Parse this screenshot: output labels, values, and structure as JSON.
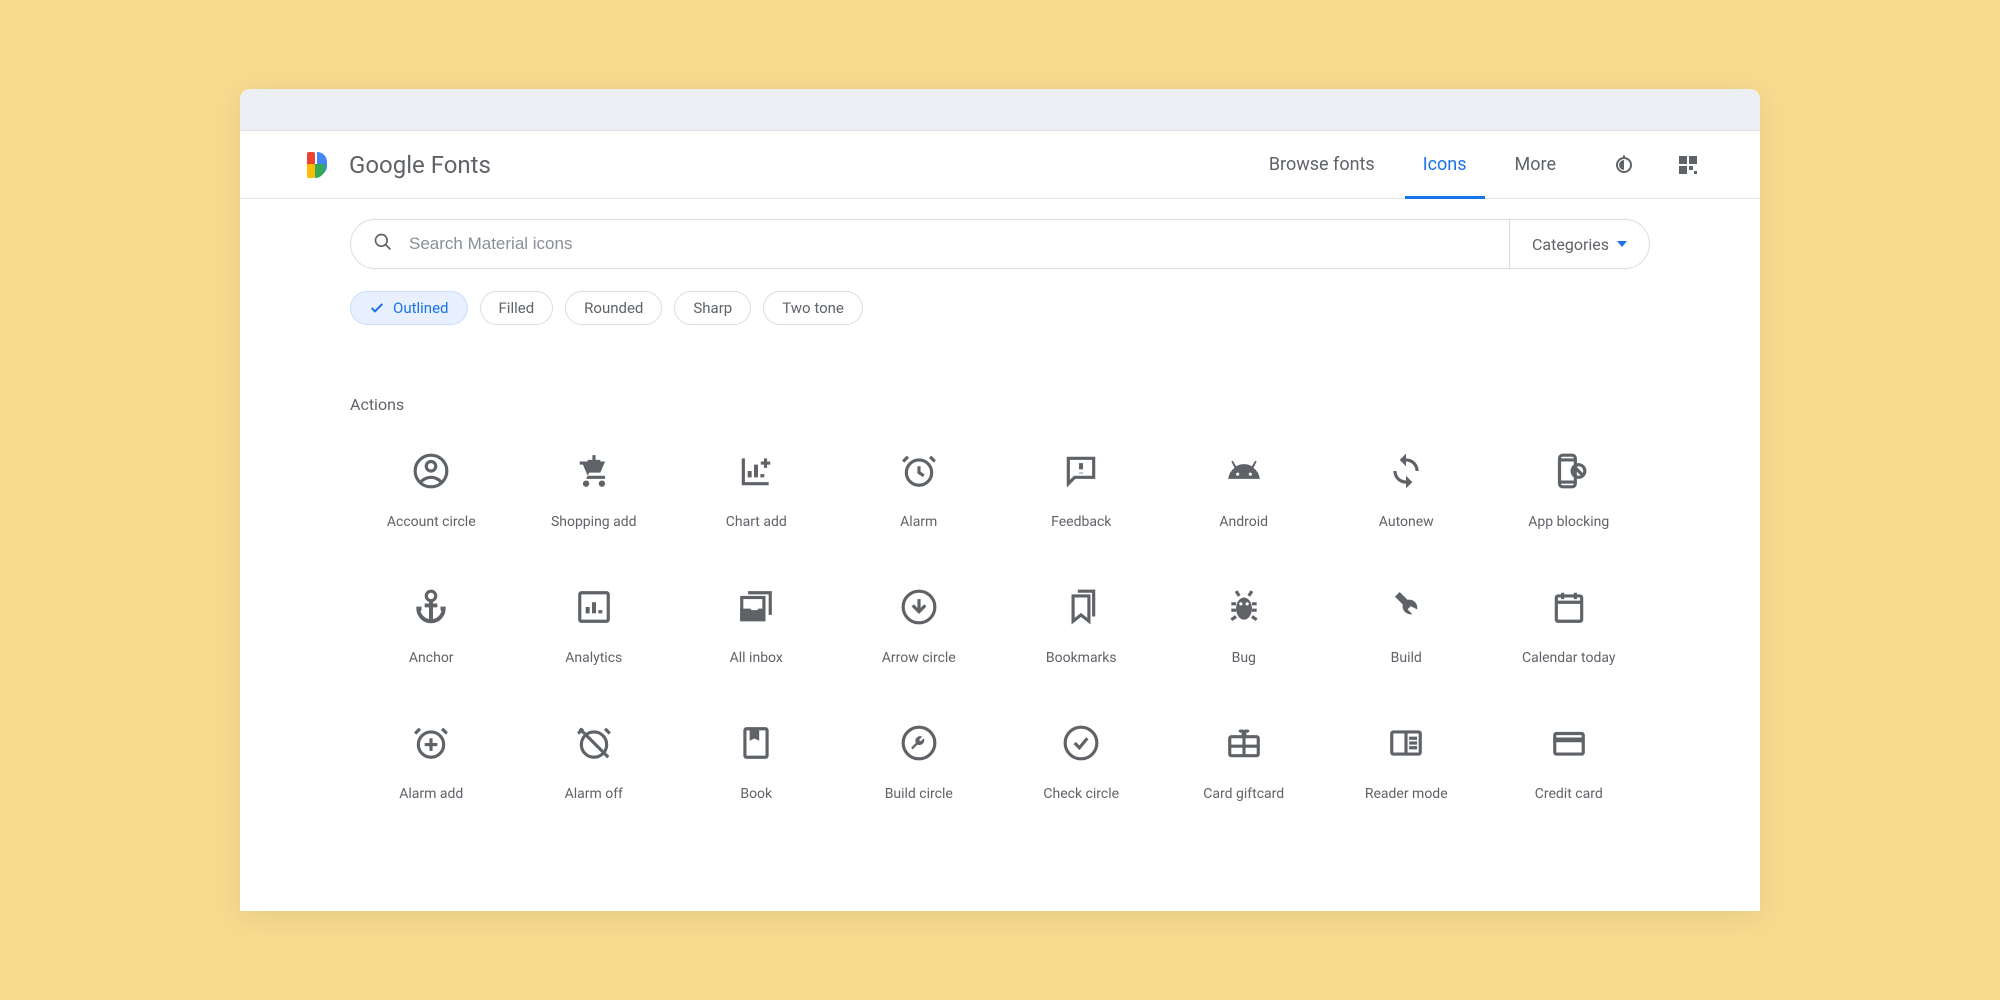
{
  "header": {
    "brand_google": "Google",
    "brand_fonts": " Fonts",
    "nav": {
      "browse": "Browse fonts",
      "icons": "Icons",
      "more": "More"
    }
  },
  "search": {
    "placeholder": "Search Material icons",
    "categories_label": "Categories"
  },
  "chips": {
    "outlined": "Outlined",
    "filled": "Filled",
    "rounded": "Rounded",
    "sharp": "Sharp",
    "twotone": "Two tone"
  },
  "section": {
    "actions": "Actions"
  },
  "icons": {
    "r1c1": "Account circle",
    "r1c2": "Shopping add",
    "r1c3": "Chart add",
    "r1c4": "Alarm",
    "r1c5": "Feedback",
    "r1c6": "Android",
    "r1c7": "Autonew",
    "r1c8": "App blocking",
    "r2c1": "Anchor",
    "r2c2": "Analytics",
    "r2c3": "All inbox",
    "r2c4": "Arrow circle",
    "r2c5": "Bookmarks",
    "r2c6": "Bug",
    "r2c7": "Build",
    "r2c8": "Calendar today",
    "r3c1": "Alarm add",
    "r3c2": "Alarm off",
    "r3c3": "Book",
    "r3c4": "Build circle",
    "r3c5": "Check circle",
    "r3c6": "Card giftcard",
    "r3c7": "Reader mode",
    "r3c8": "Credit card"
  }
}
